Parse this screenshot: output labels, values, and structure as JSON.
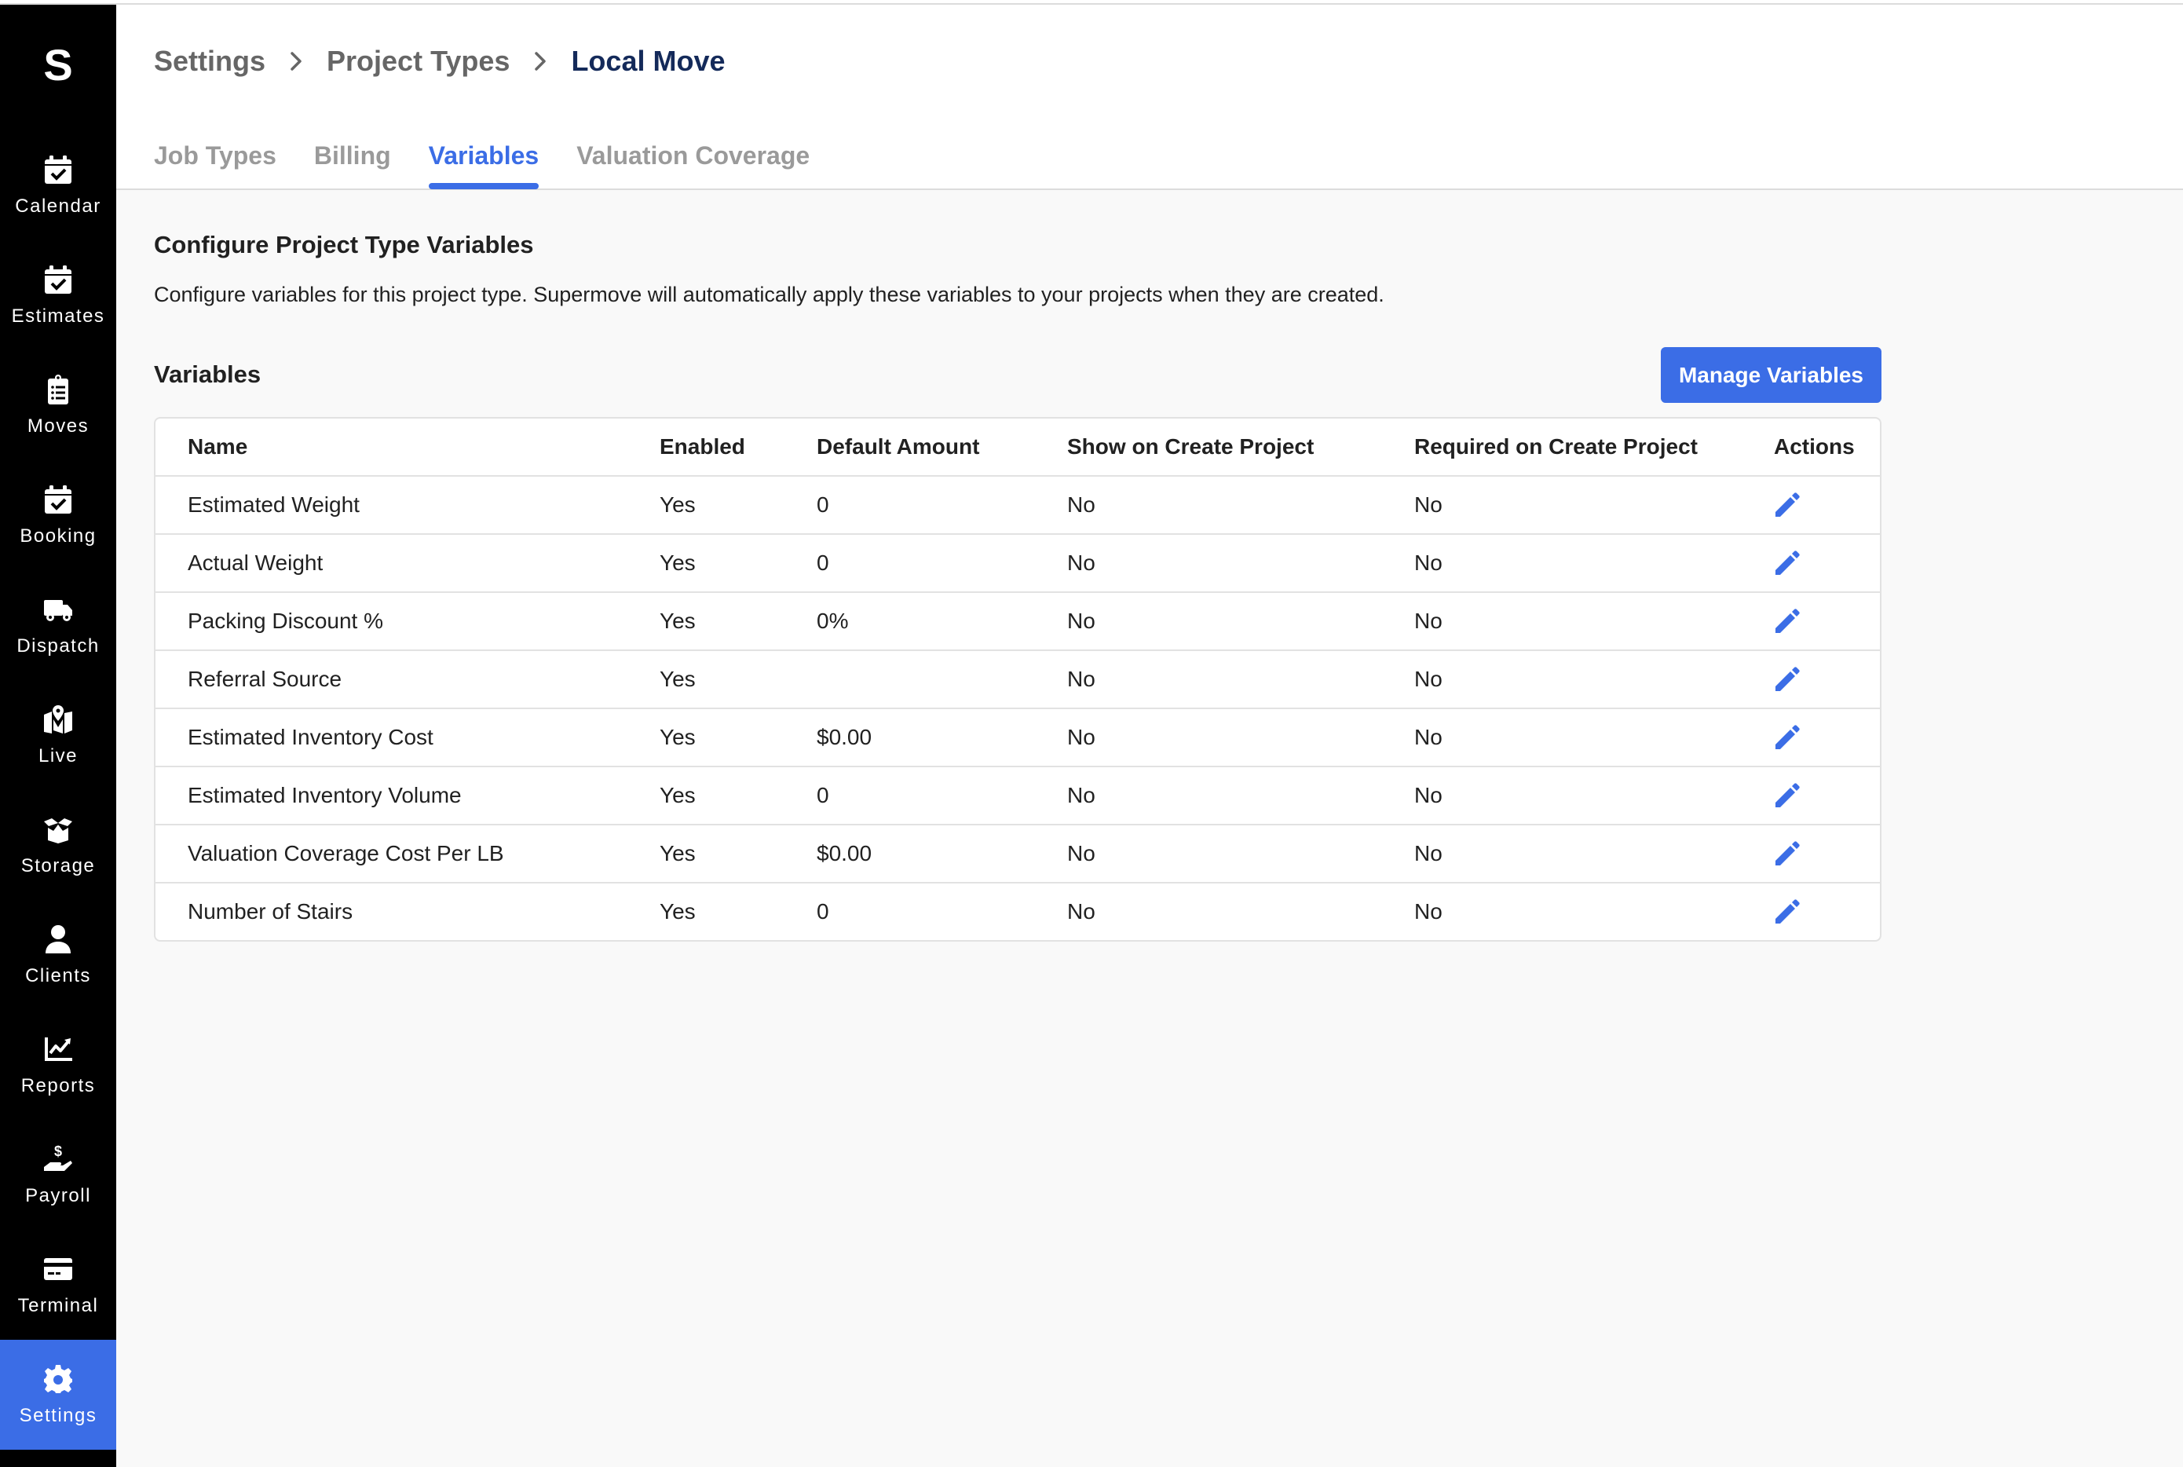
{
  "app": {
    "logo": "S"
  },
  "sidebar": {
    "items": [
      {
        "label": "Calendar",
        "icon": "calendar-check-icon",
        "active": false
      },
      {
        "label": "Estimates",
        "icon": "calendar-check-icon",
        "active": false
      },
      {
        "label": "Moves",
        "icon": "clipboard-list-icon",
        "active": false
      },
      {
        "label": "Booking",
        "icon": "calendar-check-icon",
        "active": false
      },
      {
        "label": "Dispatch",
        "icon": "truck-icon",
        "active": false
      },
      {
        "label": "Live",
        "icon": "map-marker-icon",
        "active": false
      },
      {
        "label": "Storage",
        "icon": "box-open-icon",
        "active": false
      },
      {
        "label": "Clients",
        "icon": "user-icon",
        "active": false
      },
      {
        "label": "Reports",
        "icon": "chart-line-icon",
        "active": false
      },
      {
        "label": "Payroll",
        "icon": "hand-dollar-icon",
        "active": false
      },
      {
        "label": "Terminal",
        "icon": "credit-card-icon",
        "active": false
      },
      {
        "label": "Settings",
        "icon": "gear-icon",
        "active": true
      }
    ]
  },
  "breadcrumb": {
    "items": [
      "Settings",
      "Project Types",
      "Local Move"
    ]
  },
  "tabs": {
    "items": [
      "Job Types",
      "Billing",
      "Variables",
      "Valuation Coverage"
    ],
    "active": "Variables"
  },
  "section": {
    "title": "Configure Project Type Variables",
    "description": "Configure variables for this project type. Supermove will automatically apply these variables to your projects when they are created."
  },
  "variables": {
    "title": "Variables",
    "manage_button": "Manage Variables",
    "columns": [
      "Name",
      "Enabled",
      "Default Amount",
      "Show on Create Project",
      "Required on Create Project",
      "Actions"
    ],
    "rows": [
      {
        "name": "Estimated Weight",
        "enabled": "Yes",
        "default": "0",
        "show": "No",
        "required": "No"
      },
      {
        "name": "Actual Weight",
        "enabled": "Yes",
        "default": "0",
        "show": "No",
        "required": "No"
      },
      {
        "name": "Packing Discount %",
        "enabled": "Yes",
        "default": "0%",
        "show": "No",
        "required": "No"
      },
      {
        "name": "Referral Source",
        "enabled": "Yes",
        "default": "",
        "show": "No",
        "required": "No"
      },
      {
        "name": "Estimated Inventory Cost",
        "enabled": "Yes",
        "default": "$0.00",
        "show": "No",
        "required": "No"
      },
      {
        "name": "Estimated Inventory Volume",
        "enabled": "Yes",
        "default": "0",
        "show": "No",
        "required": "No"
      },
      {
        "name": "Valuation Coverage Cost Per LB",
        "enabled": "Yes",
        "default": "$0.00",
        "show": "No",
        "required": "No"
      },
      {
        "name": "Number of Stairs",
        "enabled": "Yes",
        "default": "0",
        "show": "No",
        "required": "No"
      }
    ],
    "row_action_icon": "pencil-icon"
  },
  "colors": {
    "accent": "#3b6de6",
    "sidebar_bg": "#000000",
    "breadcrumb_current": "#142a5a",
    "breadcrumb": "#666666",
    "tab_inactive": "#9a9a9a"
  }
}
